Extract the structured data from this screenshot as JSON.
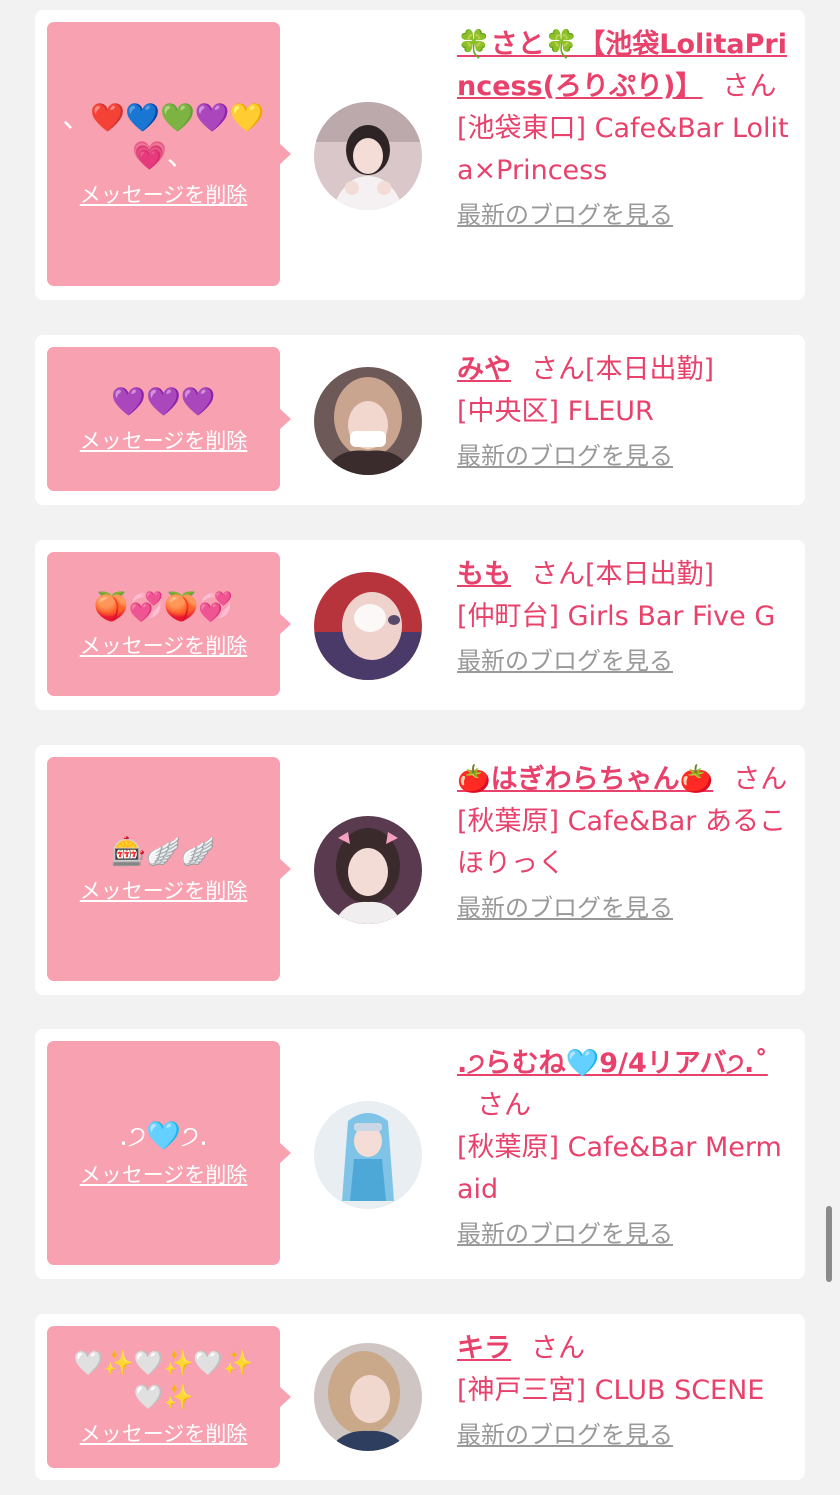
{
  "cards": [
    {
      "message": "、❤️💙💚💜💛💗、",
      "delete_label": "メッセージを削除",
      "name": "🍀さと🍀【池袋LolitaPrincess(ろりぷり)】",
      "honorific": "さん",
      "status": "",
      "shop": "[池袋東口] Cafe&Bar Lolita×Princess",
      "blog_label": "最新のブログを見る"
    },
    {
      "message": "💜💜💜",
      "delete_label": "メッセージを削除",
      "name": "みや",
      "honorific": "さん",
      "status": "[本日出勤]",
      "shop": "[中央区] FLEUR",
      "blog_label": "最新のブログを見る"
    },
    {
      "message": "🍑💞🍑💞",
      "delete_label": "メッセージを削除",
      "name": "もも",
      "honorific": "さん",
      "status": "[本日出勤]",
      "shop": "[仲町台] Girls Bar Five G",
      "blog_label": "最新のブログを見る"
    },
    {
      "message": "🎰🪽🪽",
      "delete_label": "メッセージを削除",
      "name": "🍅はぎわらちゃん🍅",
      "honorific": "さん",
      "status": "",
      "shop": "[秋葉原] Cafe&Bar あるこほりっく",
      "blog_label": "最新のブログを見る"
    },
    {
      "message": ".੭🩵੭.",
      "delete_label": "メッセージを削除",
      "name": ".੭らむね🩵9/4リアバ੭.˚",
      "honorific": "さん",
      "status": "",
      "shop": "[秋葉原] Cafe&Bar Mermaid",
      "blog_label": "最新のブログを見る"
    },
    {
      "message": "🤍✨🤍✨🤍✨🤍✨",
      "delete_label": "メッセージを削除",
      "name": "キラ",
      "honorific": "さん",
      "status": "",
      "shop": "[神戸三宮] CLUB SCENE",
      "blog_label": "最新のブログを見る"
    }
  ],
  "colors": {
    "page_bg": "#f2f2f2",
    "card_bg": "#ffffff",
    "bubble_bg": "#f7a1b1",
    "accent": "#e8416b",
    "muted_link": "#999999"
  }
}
